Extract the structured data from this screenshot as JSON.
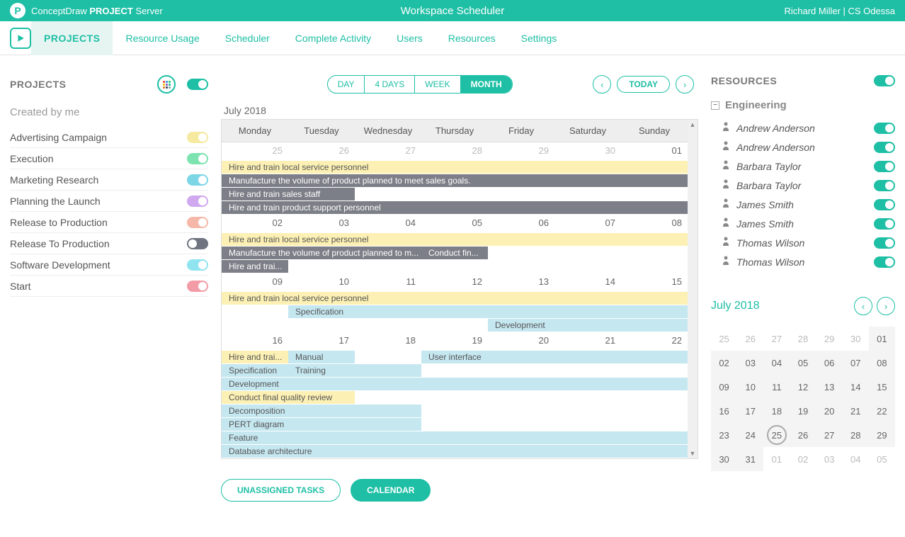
{
  "header": {
    "brand_prefix": "ConceptDraw ",
    "brand_bold": "PROJECT",
    "brand_suffix": " Server",
    "app_title": "Workspace Scheduler",
    "user": "Richard Miller | CS Odessa"
  },
  "tabs": {
    "projects": "PROJECTS",
    "resource_usage": "Resource Usage",
    "scheduler": "Scheduler",
    "complete_activity": "Complete Activity",
    "users": "Users",
    "resources": "Resources",
    "settings": "Settings"
  },
  "left": {
    "title": "PROJECTS",
    "subtitle": "Created by me",
    "items": [
      {
        "label": "Advertising Campaign",
        "color": "#f5eaa0"
      },
      {
        "label": "Execution",
        "color": "#7de3b0"
      },
      {
        "label": "Marketing Research",
        "color": "#7cd6e6"
      },
      {
        "label": "Planning the Launch",
        "color": "#cfa8ef"
      },
      {
        "label": "Release to Production",
        "color": "#f5b8a8"
      },
      {
        "label": "Release To Production",
        "color": "#6f7480",
        "off": true
      },
      {
        "label": "Software Development",
        "color": "#8fe4f0"
      },
      {
        "label": "Start",
        "color": "#f39ca8"
      }
    ]
  },
  "calendar": {
    "views": {
      "day": "DAY",
      "four_days": "4 DAYS",
      "week": "WEEK",
      "month": "MONTH"
    },
    "today": "TODAY",
    "month_label": "July 2018",
    "day_headers": [
      "Monday",
      "Tuesday",
      "Wednesday",
      "Thursday",
      "Friday",
      "Saturday",
      "Sunday"
    ],
    "weeks": [
      {
        "nums": [
          "25",
          "26",
          "27",
          "28",
          "29",
          "30",
          "01"
        ],
        "in": [
          false,
          false,
          false,
          false,
          false,
          false,
          true
        ]
      },
      {
        "nums": [
          "02",
          "03",
          "04",
          "05",
          "06",
          "07",
          "08"
        ],
        "in": [
          true,
          true,
          true,
          true,
          true,
          true,
          true
        ]
      },
      {
        "nums": [
          "09",
          "10",
          "11",
          "12",
          "13",
          "14",
          "15"
        ],
        "in": [
          true,
          true,
          true,
          true,
          true,
          true,
          true
        ]
      },
      {
        "nums": [
          "16",
          "17",
          "18",
          "19",
          "20",
          "21",
          "22"
        ],
        "in": [
          true,
          true,
          true,
          true,
          true,
          true,
          true
        ]
      }
    ],
    "tasks": {
      "w0": [
        {
          "label": "Hire and train local service personnel",
          "cls": "yellow-task",
          "start": 0,
          "span": 7
        },
        {
          "label": "Manufacture the volume of product planned to meet sales goals.",
          "cls": "gray-task",
          "start": 0,
          "span": 7
        },
        {
          "label": "Hire and train sales staff",
          "cls": "gray-task",
          "start": 0,
          "span": 2
        },
        {
          "label": "Hire and train product support personnel",
          "cls": "gray-task",
          "start": 0,
          "span": 7
        }
      ],
      "w1": [
        {
          "label": "Hire and train local service personnel",
          "cls": "yellow-task",
          "start": 0,
          "span": 7
        },
        {
          "label": "Manufacture the volume of product planned to m...",
          "cls": "gray-task",
          "start": 0,
          "span": 3
        },
        {
          "label": "Conduct fin...",
          "cls": "gray-task",
          "start": 3,
          "span": 1
        },
        {
          "label": "Hire and trai...",
          "cls": "gray-task",
          "start": 0,
          "span": 1
        }
      ],
      "w2": [
        {
          "label": "Hire and train local service personnel",
          "cls": "yellow-task",
          "start": 0,
          "span": 7
        },
        {
          "label": "Specification",
          "cls": "blue-task",
          "start": 1,
          "span": 6
        },
        {
          "label": "Development",
          "cls": "blue-task",
          "start": 4,
          "span": 3
        }
      ],
      "w3": [
        {
          "label": "Hire and trai...",
          "cls": "yellow-task",
          "start": 0,
          "span": 1
        },
        {
          "label": "Manual",
          "cls": "blue-task",
          "start": 1,
          "span": 1
        },
        {
          "label": "Specification",
          "cls": "blue-task",
          "start": 0,
          "span": 1
        },
        {
          "label": "Training",
          "cls": "blue-task",
          "start": 1,
          "span": 2
        },
        {
          "label": "Development",
          "cls": "blue-task",
          "start": 0,
          "span": 7
        },
        {
          "label": "Conduct final quality review",
          "cls": "yellow-task",
          "start": 0,
          "span": 2
        },
        {
          "label": "User interface",
          "cls": "blue-task",
          "start": 3,
          "span": 4
        },
        {
          "label": "Decomposition",
          "cls": "blue-task",
          "start": 0,
          "span": 3
        },
        {
          "label": "PERT diagram",
          "cls": "blue-task",
          "start": 0,
          "span": 3
        },
        {
          "label": "Feature",
          "cls": "blue-task",
          "start": 0,
          "span": 7
        },
        {
          "label": "Database architecture",
          "cls": "blue-task",
          "start": 0,
          "span": 7
        }
      ]
    }
  },
  "bottom": {
    "unassigned": "UNASSIGNED TASKS",
    "calendar": "CALENDAR"
  },
  "right": {
    "title": "RESOURCES",
    "group": "Engineering",
    "items": [
      "Andrew Anderson",
      "Andrew Anderson",
      "Barbara Taylor",
      "Barbara Taylor",
      "James Smith",
      "James Smith",
      "Thomas Wilson",
      "Thomas Wilson"
    ]
  },
  "mini": {
    "title": "July 2018",
    "cells": [
      {
        "d": "25",
        "o": true
      },
      {
        "d": "26",
        "o": true
      },
      {
        "d": "27",
        "o": true
      },
      {
        "d": "28",
        "o": true
      },
      {
        "d": "29",
        "o": true
      },
      {
        "d": "30",
        "o": true
      },
      {
        "d": "01"
      },
      {
        "d": "02"
      },
      {
        "d": "03"
      },
      {
        "d": "04"
      },
      {
        "d": "05"
      },
      {
        "d": "06"
      },
      {
        "d": "07"
      },
      {
        "d": "08"
      },
      {
        "d": "09"
      },
      {
        "d": "10"
      },
      {
        "d": "11"
      },
      {
        "d": "12"
      },
      {
        "d": "13"
      },
      {
        "d": "14"
      },
      {
        "d": "15"
      },
      {
        "d": "16"
      },
      {
        "d": "17"
      },
      {
        "d": "18"
      },
      {
        "d": "19"
      },
      {
        "d": "20"
      },
      {
        "d": "21"
      },
      {
        "d": "22"
      },
      {
        "d": "23"
      },
      {
        "d": "24"
      },
      {
        "d": "25",
        "sel": true
      },
      {
        "d": "26"
      },
      {
        "d": "27"
      },
      {
        "d": "28"
      },
      {
        "d": "29"
      },
      {
        "d": "30"
      },
      {
        "d": "31"
      },
      {
        "d": "01",
        "o": true
      },
      {
        "d": "02",
        "o": true
      },
      {
        "d": "03",
        "o": true
      },
      {
        "d": "04",
        "o": true
      },
      {
        "d": "05",
        "o": true
      }
    ]
  },
  "colors": {
    "accent": "#1ebfa5"
  }
}
